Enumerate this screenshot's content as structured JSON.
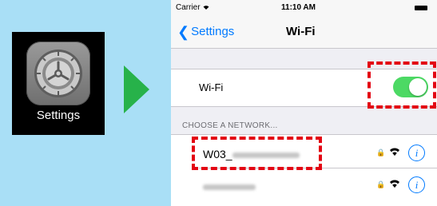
{
  "app": {
    "label": "Settings",
    "icon": "settings-gear-icon"
  },
  "arrow": {
    "color": "#27b24a"
  },
  "status_bar": {
    "carrier": "Carrier",
    "time": "11:10 AM"
  },
  "nav": {
    "back_label": "Settings",
    "title": "Wi-Fi"
  },
  "wifi": {
    "label": "Wi-Fi",
    "enabled": true,
    "toggle_color": "#4cd964"
  },
  "networks": {
    "header": "CHOOSE A NETWORK...",
    "items": [
      {
        "name_prefix": "W03_",
        "secured": true
      },
      {
        "name_prefix": "",
        "secured": true
      }
    ]
  },
  "colors": {
    "accent": "#007aff",
    "highlight": "#e30613",
    "background": "#a9dff6"
  }
}
